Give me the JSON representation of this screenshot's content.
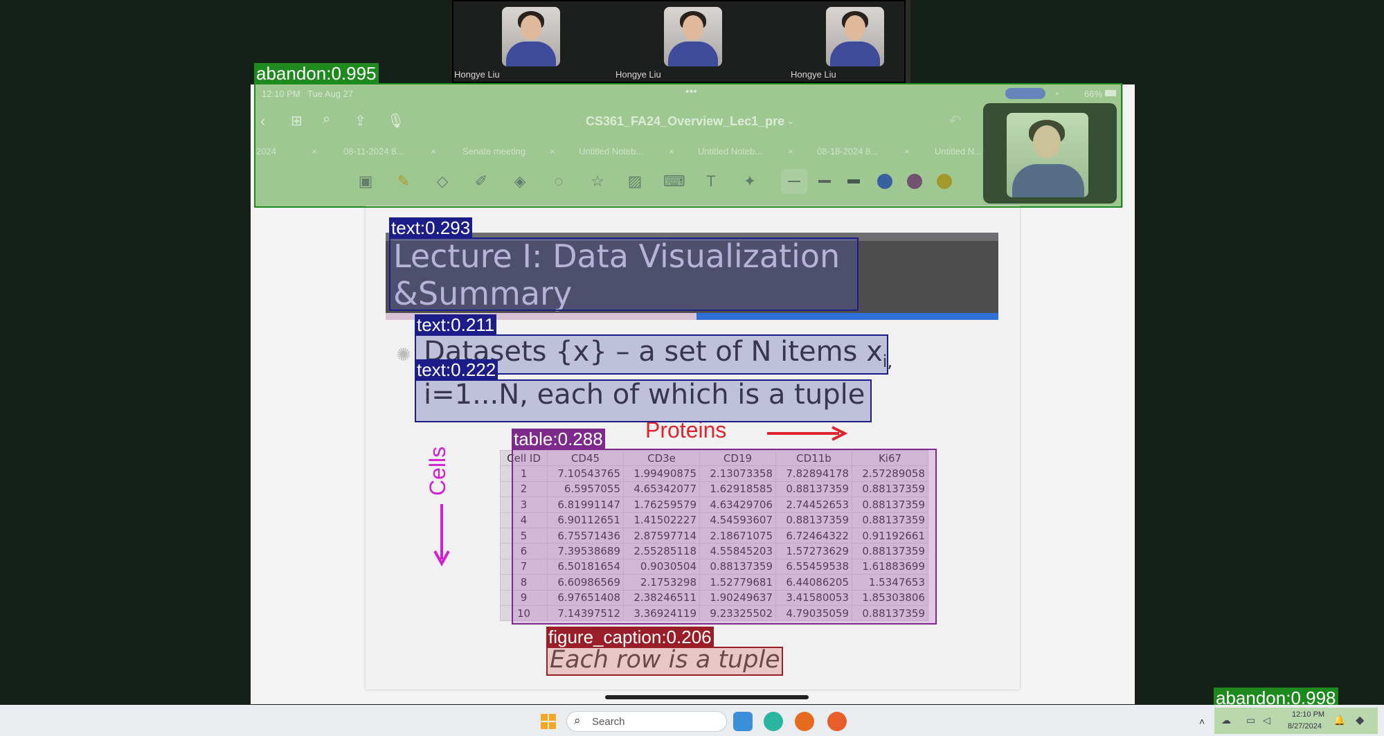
{
  "participants": [
    {
      "name": "Hongye Liu"
    },
    {
      "name": "Hongye Liu"
    },
    {
      "name": "Hongye Liu"
    }
  ],
  "ipad": {
    "status_time": "12:10 PM",
    "status_date": "Tue Aug 27",
    "battery": "66%",
    "document_title": "CS361_FA24_Overview_Lec1_pre",
    "tabs": [
      "2024",
      "08-11-2024 8...",
      "Senate meeting",
      "Untitled Noteb...",
      "Untitled Noteb...",
      "08-18-2024 8...",
      "Untitled N..."
    ],
    "pen_colors": [
      "#1d3fae",
      "#6b2a6e",
      "#a98a13"
    ]
  },
  "slide": {
    "title_line1": "Lecture I: Data Visualization",
    "title_line2": "&Summary",
    "bullet_line1": "Datasets {x} – a set of N items x",
    "bullet_line1_sub": "i,",
    "bullet_line2": "i=1...N, each of which is a tuple",
    "proteins_label": "Proteins",
    "cells_label": "Cells",
    "caption": "Each row  is a tuple",
    "table": {
      "headers": [
        "Cell ID",
        "CD45",
        "CD3e",
        "CD19",
        "CD11b",
        "Ki67"
      ],
      "rows": [
        [
          "1",
          "7.10543765",
          "1.99490875",
          "2.13073358",
          "7.82894178",
          "2.57289058"
        ],
        [
          "2",
          "6.5957055",
          "4.65342077",
          "1.62918585",
          "0.88137359",
          "0.88137359"
        ],
        [
          "3",
          "6.81991147",
          "1.76259579",
          "4.63429706",
          "2.74452653",
          "0.88137359"
        ],
        [
          "4",
          "6.90112651",
          "1.41502227",
          "4.54593607",
          "0.88137359",
          "0.88137359"
        ],
        [
          "5",
          "6.75571436",
          "2.87597714",
          "2.18671075",
          "6.72464322",
          "0.91192661"
        ],
        [
          "6",
          "7.39538689",
          "2.55285118",
          "4.55845203",
          "1.57273629",
          "0.88137359"
        ],
        [
          "7",
          "6.50181654",
          "0.9030504",
          "0.88137359",
          "6.55459538",
          "1.61883699"
        ],
        [
          "8",
          "6.60986569",
          "2.1753298",
          "1.52779681",
          "6.44086205",
          "1.5347653"
        ],
        [
          "9",
          "6.97651408",
          "2.38246511",
          "1.90249637",
          "3.41580053",
          "1.85303806"
        ],
        [
          "10",
          "7.14397512",
          "3.36924119",
          "9.23325502",
          "4.79035059",
          "0.88137359"
        ]
      ]
    }
  },
  "detections": [
    {
      "label": "abandon:0.995",
      "color": "#1e8a1e"
    },
    {
      "label": "text:0.293",
      "color": "#1d1d8a"
    },
    {
      "label": "text:0.211",
      "color": "#1d1d8a"
    },
    {
      "label": "text:0.222",
      "color": "#1d1d8a"
    },
    {
      "label": "table:0.288",
      "color": "#7d2a8c"
    },
    {
      "label": "figure_caption:0.206",
      "color": "#9a1e28"
    },
    {
      "label": "abandon:0.998",
      "color": "#1e8a1e"
    }
  ],
  "taskbar": {
    "search_placeholder": "Search",
    "clock_time": "12:10 PM",
    "clock_date": "8/27/2024"
  }
}
